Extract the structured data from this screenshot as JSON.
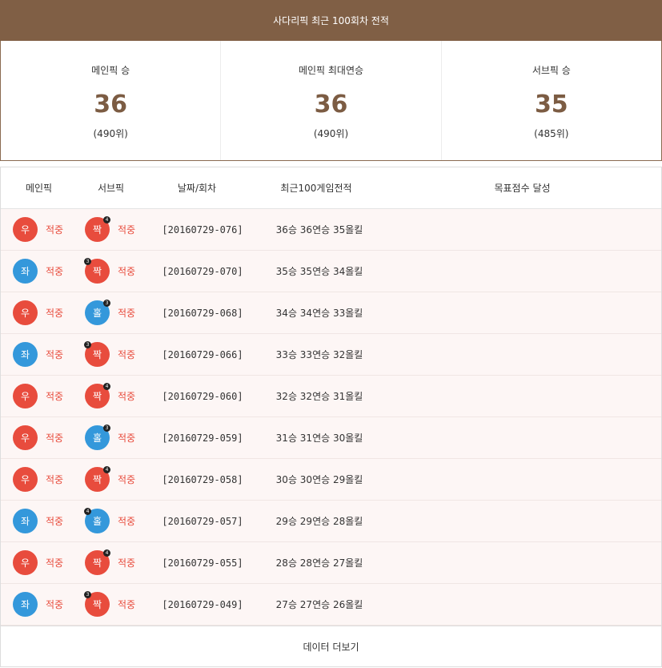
{
  "header": {
    "title": "사다리픽 최근 100회차 전적"
  },
  "stats": [
    {
      "label": "메인픽 승",
      "value": "36",
      "rank": "(490위)"
    },
    {
      "label": "메인픽 최대연승",
      "value": "36",
      "rank": "(490위)"
    },
    {
      "label": "서브픽 승",
      "value": "35",
      "rank": "(485위)"
    }
  ],
  "table": {
    "headers": {
      "main": "메인픽",
      "sub": "서브픽",
      "date": "날짜/회차",
      "record": "최근100게임전적",
      "goal": "목표점수 달성"
    },
    "rows": [
      {
        "main": {
          "label": "우",
          "color": "#e84c3d",
          "result": "적중"
        },
        "sub": {
          "label": "짝",
          "color": "#e84c3d",
          "badge": "4",
          "badge_side": "right",
          "result": "적중"
        },
        "date": "[20160729-076]",
        "record": "36승 36연승 35올킬",
        "goal": ""
      },
      {
        "main": {
          "label": "좌",
          "color": "#3498db",
          "result": "적중"
        },
        "sub": {
          "label": "짝",
          "color": "#e84c3d",
          "badge": "3",
          "badge_side": "left",
          "result": "적중"
        },
        "date": "[20160729-070]",
        "record": "35승 35연승 34올킬",
        "goal": ""
      },
      {
        "main": {
          "label": "우",
          "color": "#e84c3d",
          "result": "적중"
        },
        "sub": {
          "label": "홀",
          "color": "#3498db",
          "badge": "3",
          "badge_side": "right",
          "result": "적중"
        },
        "date": "[20160729-068]",
        "record": "34승 34연승 33올킬",
        "goal": ""
      },
      {
        "main": {
          "label": "좌",
          "color": "#3498db",
          "result": "적중"
        },
        "sub": {
          "label": "짝",
          "color": "#e84c3d",
          "badge": "3",
          "badge_side": "left",
          "result": "적중"
        },
        "date": "[20160729-066]",
        "record": "33승 33연승 32올킬",
        "goal": ""
      },
      {
        "main": {
          "label": "우",
          "color": "#e84c3d",
          "result": "적중"
        },
        "sub": {
          "label": "짝",
          "color": "#e84c3d",
          "badge": "4",
          "badge_side": "right",
          "result": "적중"
        },
        "date": "[20160729-060]",
        "record": "32승 32연승 31올킬",
        "goal": ""
      },
      {
        "main": {
          "label": "우",
          "color": "#e84c3d",
          "result": "적중"
        },
        "sub": {
          "label": "홀",
          "color": "#3498db",
          "badge": "3",
          "badge_side": "right",
          "result": "적중"
        },
        "date": "[20160729-059]",
        "record": "31승 31연승 30올킬",
        "goal": ""
      },
      {
        "main": {
          "label": "우",
          "color": "#e84c3d",
          "result": "적중"
        },
        "sub": {
          "label": "짝",
          "color": "#e84c3d",
          "badge": "4",
          "badge_side": "right",
          "result": "적중"
        },
        "date": "[20160729-058]",
        "record": "30승 30연승 29올킬",
        "goal": ""
      },
      {
        "main": {
          "label": "좌",
          "color": "#3498db",
          "result": "적중"
        },
        "sub": {
          "label": "홀",
          "color": "#3498db",
          "badge": "4",
          "badge_side": "left",
          "result": "적중"
        },
        "date": "[20160729-057]",
        "record": "29승 29연승 28올킬",
        "goal": ""
      },
      {
        "main": {
          "label": "우",
          "color": "#e84c3d",
          "result": "적중"
        },
        "sub": {
          "label": "짝",
          "color": "#e84c3d",
          "badge": "4",
          "badge_side": "right",
          "result": "적중"
        },
        "date": "[20160729-055]",
        "record": "28승 28연승 27올킬",
        "goal": ""
      },
      {
        "main": {
          "label": "좌",
          "color": "#3498db",
          "result": "적중"
        },
        "sub": {
          "label": "짝",
          "color": "#e84c3d",
          "badge": "3",
          "badge_side": "left",
          "result": "적중"
        },
        "date": "[20160729-049]",
        "record": "27승 27연승 26올킬",
        "goal": ""
      }
    ]
  },
  "more_button": {
    "label": "데이터 더보기"
  }
}
